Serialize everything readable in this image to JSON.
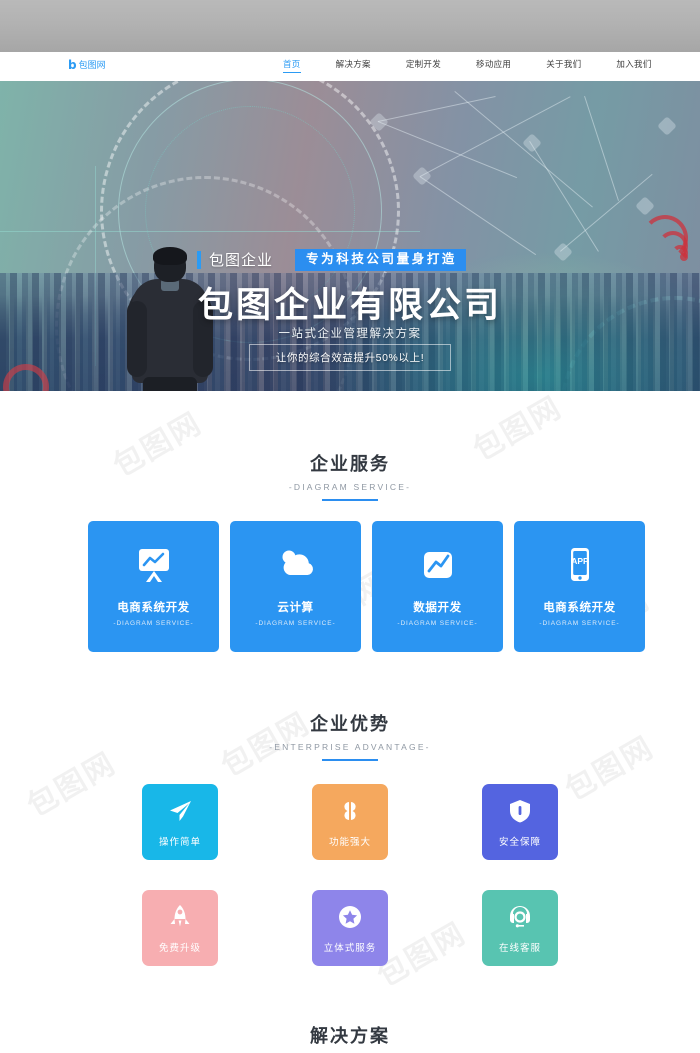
{
  "nav": {
    "logo_mark": "b",
    "logo_text": "包图网",
    "items": [
      {
        "label": "首页",
        "active": true
      },
      {
        "label": "解决方案",
        "active": false
      },
      {
        "label": "定制开发",
        "active": false
      },
      {
        "label": "移动应用",
        "active": false
      },
      {
        "label": "关于我们",
        "active": false
      },
      {
        "label": "加入我们",
        "active": false
      }
    ]
  },
  "hero": {
    "tag": "包图企业",
    "badge": "专为科技公司量身打造",
    "title": "包图企业有限公司",
    "subtitle": "一站式企业管理解决方案",
    "cta": "让你的综合效益提升50%以上!"
  },
  "services_section": {
    "title": "企业服务",
    "subtitle": "-DIAGRAM SERVICE-",
    "cards": [
      {
        "label": "电商系统开发",
        "sub": "-DIAGRAM SERVICE-",
        "icon": "presentation-chart-icon"
      },
      {
        "label": "云计算",
        "sub": "-DIAGRAM SERVICE-",
        "icon": "cloud-icon"
      },
      {
        "label": "数据开发",
        "sub": "-DIAGRAM SERVICE-",
        "icon": "chart-square-icon"
      },
      {
        "label": "电商系统开发",
        "sub": "-DIAGRAM SERVICE-",
        "icon": "mobile-app-icon"
      }
    ]
  },
  "advantages_section": {
    "title": "企业优势",
    "subtitle": "-ENTERPRISE ADVANTAGE-",
    "tiles": [
      {
        "label": "操作简单",
        "icon": "paper-plane-icon",
        "color": "#18b7e8"
      },
      {
        "label": "功能强大",
        "icon": "four-petals-icon",
        "color": "#f5a85e"
      },
      {
        "label": "安全保障",
        "icon": "shield-icon",
        "color": "#5464e0"
      },
      {
        "label": "免费升级",
        "icon": "rocket-icon",
        "color": "#f7aeb1"
      },
      {
        "label": "立体式服务",
        "icon": "star-circle-icon",
        "color": "#8e85ea"
      },
      {
        "label": "在线客服",
        "icon": "headset-icon",
        "color": "#58c4b1"
      }
    ]
  },
  "solutions_section": {
    "title": "解决方案"
  },
  "watermarks": [
    "包图网",
    "包图网",
    "包图网",
    "包图网",
    "包图网",
    "包图网",
    "包图网",
    "包图网"
  ],
  "colors": {
    "accent_blue": "#2b8ef0",
    "card_blue": "#2b95f2",
    "heading": "#333941",
    "muted": "#8f98a3",
    "topband": "#b2b2b2"
  }
}
